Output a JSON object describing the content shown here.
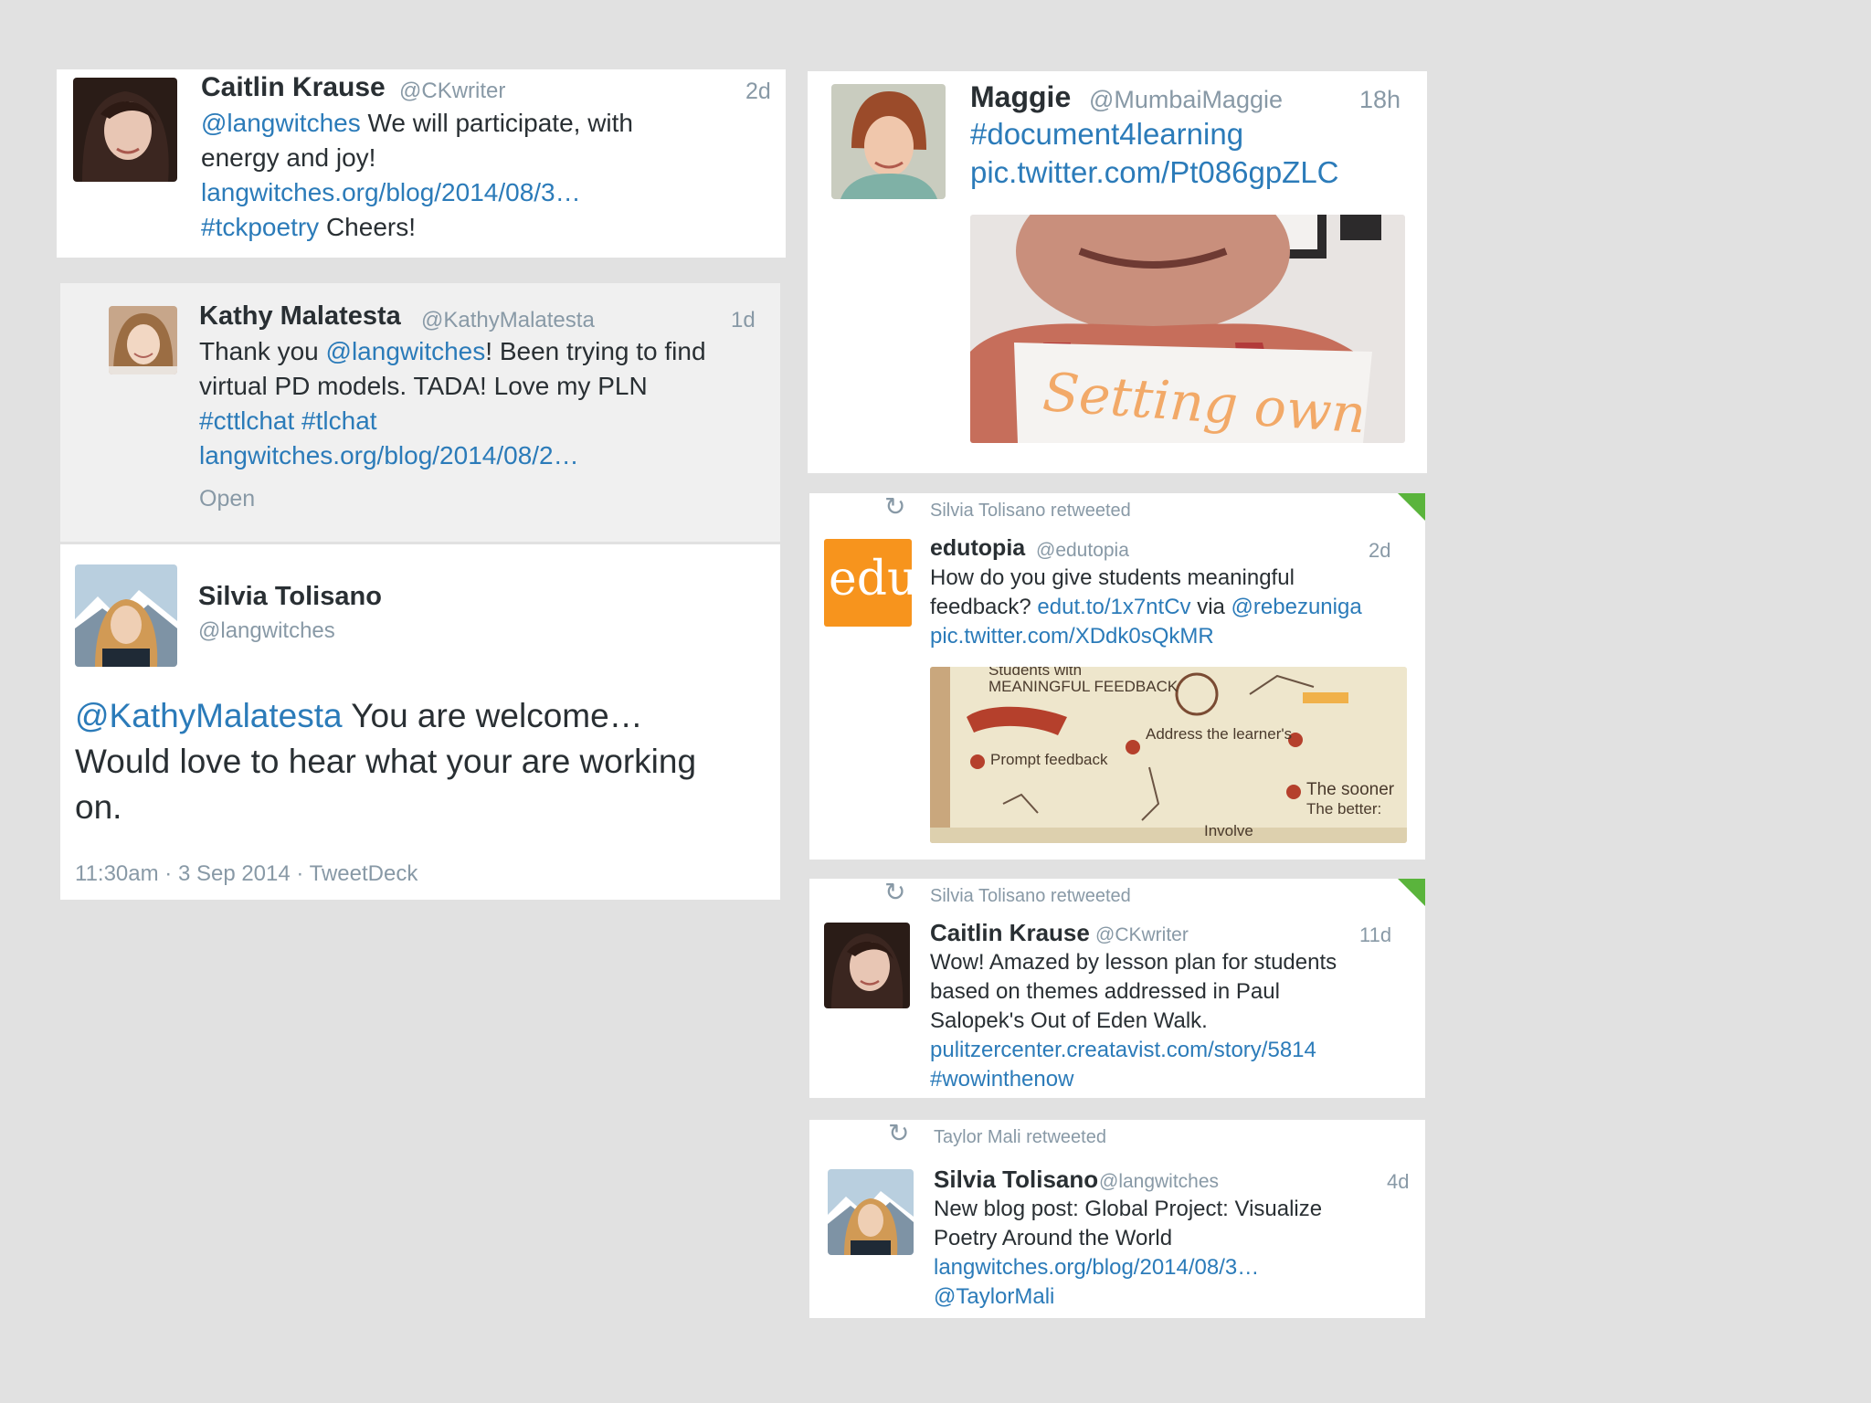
{
  "tweets": {
    "t1": {
      "name": "Caitlin Krause",
      "handle": "@CKwriter",
      "time": "2d",
      "l1_mention": "@langwitches",
      "l1_text": " We will participate, with",
      "l2_text": "energy and joy!",
      "l3_link": "langwitches.org/blog/2014/08/3…",
      "l4_hashtag": "#tckpoetry",
      "l4_text": " Cheers!"
    },
    "t2": {
      "name": "Kathy Malatesta",
      "handle": "@KathyMalatesta",
      "time": "1d",
      "l1_text_a": "Thank you ",
      "l1_mention": "@langwitches",
      "l1_text_b": "! Been trying to find",
      "l2_text": "virtual PD models. TADA! Love my PLN",
      "l3_hashtags": "#cttlchat #tlchat",
      "l4_link": "langwitches.org/blog/2014/08/2…",
      "open_label": "Open"
    },
    "t3": {
      "name": "Silvia Tolisano",
      "handle": "@langwitches",
      "l1_mention": "@KathyMalatesta",
      "l1_text": " You are welcome…",
      "l2_text": "Would love to hear what your are working",
      "l3_text": "on.",
      "meta": "11:30am · 3 Sep 2014 · TweetDeck"
    },
    "t4": {
      "name": "Maggie",
      "handle": "@MumbaiMaggie",
      "time": "18h",
      "l1_hashtag": "#document4learning",
      "l2_link": "pic.twitter.com/Pt086gpZLC",
      "photo_caption": "Setting own"
    },
    "t5": {
      "retweeted_by": "Silvia Tolisano retweeted",
      "avatar_text": "edu",
      "name": "edutopia",
      "handle": "@edutopia",
      "time": "2d",
      "l1_text": "How do you give students meaningful",
      "l2_text_a": "feedback? ",
      "l2_link": "edut.to/1x7ntCv",
      "l2_text_b": " via ",
      "l2_mention": "@rebezuniga",
      "l3_link": "pic.twitter.com/XDdk0sQkMR",
      "sketch": {
        "title_a": "Students with",
        "title_b": "MEANINGFUL FEEDBACK",
        "prompt": "Prompt feedback",
        "address": "Address the learner's",
        "sooner_a": "The sooner",
        "sooner_b": "The better:",
        "involve": "Involve"
      }
    },
    "t6": {
      "retweeted_by": "Silvia Tolisano retweeted",
      "name": "Caitlin Krause",
      "handle": "@CKwriter",
      "time": "11d",
      "l1_text": "Wow! Amazed by lesson plan for students",
      "l2_text": "based on themes addressed in Paul",
      "l3_text": "Salopek's Out of Eden Walk.",
      "l4_link": "pulitzercenter.creatavist.com/story/5814",
      "l5_hashtag": "#wowinthenow"
    },
    "t7": {
      "retweeted_by": "Taylor Mali retweeted",
      "name": "Silvia Tolisano",
      "handle": "@langwitches",
      "time": "4d",
      "l1_text": "New blog post: Global Project: Visualize",
      "l2_text": "Poetry Around the World",
      "l3_link": "langwitches.org/blog/2014/08/3…",
      "l4_mention": "@TaylorMali"
    }
  },
  "icons": {
    "retweet": "↻"
  },
  "colors": {
    "link": "#2b7bb9",
    "edutopia_orange": "#f7941d",
    "retweet_corner": "#5ab43c"
  }
}
